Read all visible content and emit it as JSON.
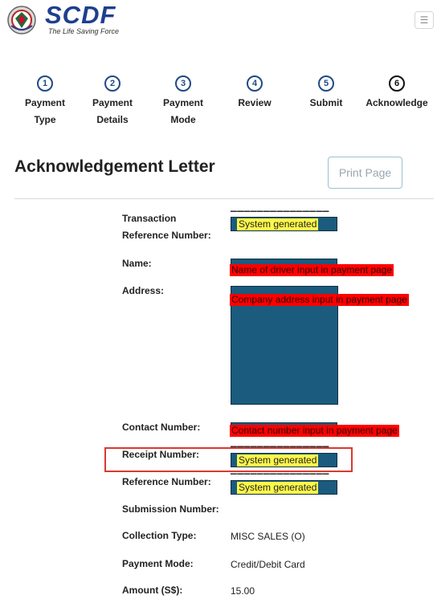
{
  "header": {
    "logo_text": "SCDF",
    "tagline": "The Life Saving Force",
    "menu_icon": "hamburger-icon"
  },
  "steps": [
    {
      "number": "1",
      "label_line1": "Payment",
      "label_line2": "Type"
    },
    {
      "number": "2",
      "label_line1": "Payment",
      "label_line2": "Details"
    },
    {
      "number": "3",
      "label_line1": "Payment",
      "label_line2": "Mode"
    },
    {
      "number": "4",
      "label_line1": "Review",
      "label_line2": ""
    },
    {
      "number": "5",
      "label_line1": "Submit",
      "label_line2": ""
    },
    {
      "number": "6",
      "label_line1": "Acknowledge",
      "label_line2": ""
    }
  ],
  "page_title": "Acknowledgement Letter",
  "print_button": "Print Page",
  "details": {
    "transaction_label_1": "Transaction",
    "transaction_label_2": "Reference Number:",
    "transaction_note": "System generated",
    "name_label": "Name:",
    "name_note": "Name of driver input in payment page",
    "address_label": "Address:",
    "address_note": "Company address input in payment page",
    "contact_label": "Contact Number:",
    "contact_note": "Contact number input in payment page",
    "receipt_label": "Receipt Number:",
    "receipt_note": "System generated",
    "reference_label": "Reference Number:",
    "reference_note": "System generated",
    "submission_label": "Submission Number:",
    "collection_label": "Collection Type:",
    "collection_value": "MISC SALES (O)",
    "payment_mode_label": "Payment Mode:",
    "payment_mode_value": "Credit/Debit Card",
    "amount_label": "Amount (S$):",
    "amount_value": "15.00"
  },
  "colors": {
    "redaction": "#1a5b7e",
    "note_yellow": "#fff84a",
    "note_red": "#ff0000",
    "highlight_border": "#d9392e",
    "brand_blue": "#1e3f8f"
  }
}
